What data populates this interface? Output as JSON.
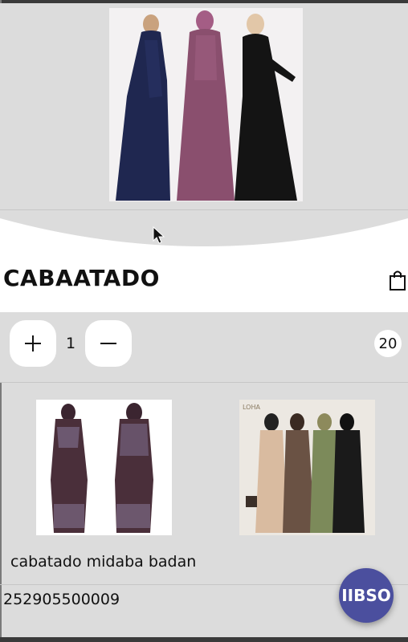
{
  "product": {
    "title": "CABAATADO",
    "quantity": "1",
    "cart_count": "20"
  },
  "related": {
    "caption": "cabatado midaba badan",
    "phone": "252905500009",
    "brand_mark": "LOHA"
  },
  "fab": {
    "label": "IIBSO"
  },
  "icons": {
    "cart": "shopping-bag-icon",
    "increase": "plus-icon",
    "decrease": "minus-icon"
  },
  "colors": {
    "accent": "#4b4f9e",
    "background": "#dcdcdc",
    "surface": "#ffffff"
  }
}
